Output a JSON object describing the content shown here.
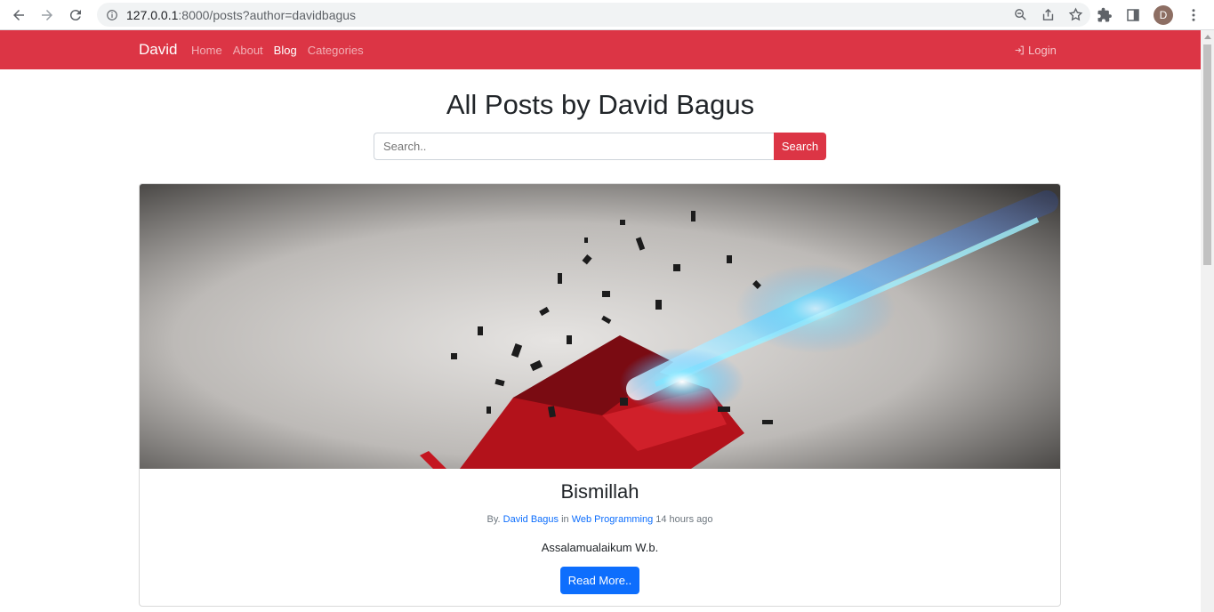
{
  "browser": {
    "url_host": "127.0.0.1",
    "url_rest": ":8000/posts?author=davidbagus",
    "profile_initial": "D"
  },
  "navbar": {
    "brand": "David",
    "items": [
      {
        "label": "Home",
        "active": false
      },
      {
        "label": "About",
        "active": false
      },
      {
        "label": "Blog",
        "active": true
      },
      {
        "label": "Categories",
        "active": false
      }
    ],
    "login_label": "Login",
    "color": "#dc3545"
  },
  "main": {
    "title": "All Posts by David Bagus",
    "search": {
      "placeholder": "Search..",
      "button_label": "Search"
    }
  },
  "post": {
    "title": "Bismillah",
    "meta_prefix": "By.",
    "author": "David Bagus",
    "meta_in": "in",
    "category": "Web Programming",
    "time": "14 hours ago",
    "excerpt": "Assalamualaikum W.b.",
    "read_more_label": "Read More.."
  },
  "colors": {
    "accent": "#dc3545",
    "link": "#0d6efd"
  }
}
